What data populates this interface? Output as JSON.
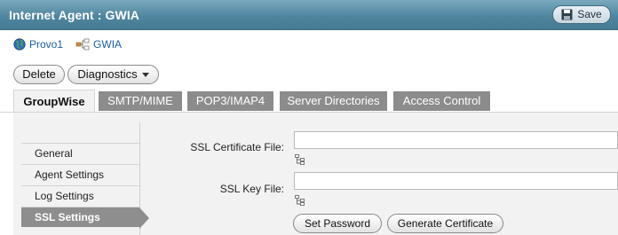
{
  "header": {
    "title": "Internet Agent : GWIA",
    "save_label": "Save"
  },
  "breadcrumbs": [
    {
      "label": "Provo1",
      "icon": "globe-icon"
    },
    {
      "label": "GWIA",
      "icon": "agent-tree-icon"
    }
  ],
  "toolbar": {
    "delete_label": "Delete",
    "diagnostics_label": "Diagnostics"
  },
  "tabs": [
    {
      "label": "GroupWise",
      "active": true
    },
    {
      "label": "SMTP/MIME",
      "active": false
    },
    {
      "label": "POP3/IMAP4",
      "active": false
    },
    {
      "label": "Server Directories",
      "active": false
    },
    {
      "label": "Access Control",
      "active": false
    }
  ],
  "nav": {
    "items": [
      {
        "label": "General",
        "active": false
      },
      {
        "label": "Agent Settings",
        "active": false
      },
      {
        "label": "Log Settings",
        "active": false
      },
      {
        "label": "SSL Settings",
        "active": true
      }
    ]
  },
  "form": {
    "ssl_cert_label": "SSL Certificate File:",
    "ssl_cert_value": "",
    "ssl_key_label": "SSL Key File:",
    "ssl_key_value": "",
    "set_password_label": "Set Password",
    "generate_cert_label": "Generate Certificate"
  },
  "colors": {
    "title_bar": "#4f869f",
    "link": "#1a5ea8",
    "tab_inactive": "#8c8c8c",
    "panel_bg": "#f2f2f2",
    "nav_active": "#8e8e8e"
  }
}
